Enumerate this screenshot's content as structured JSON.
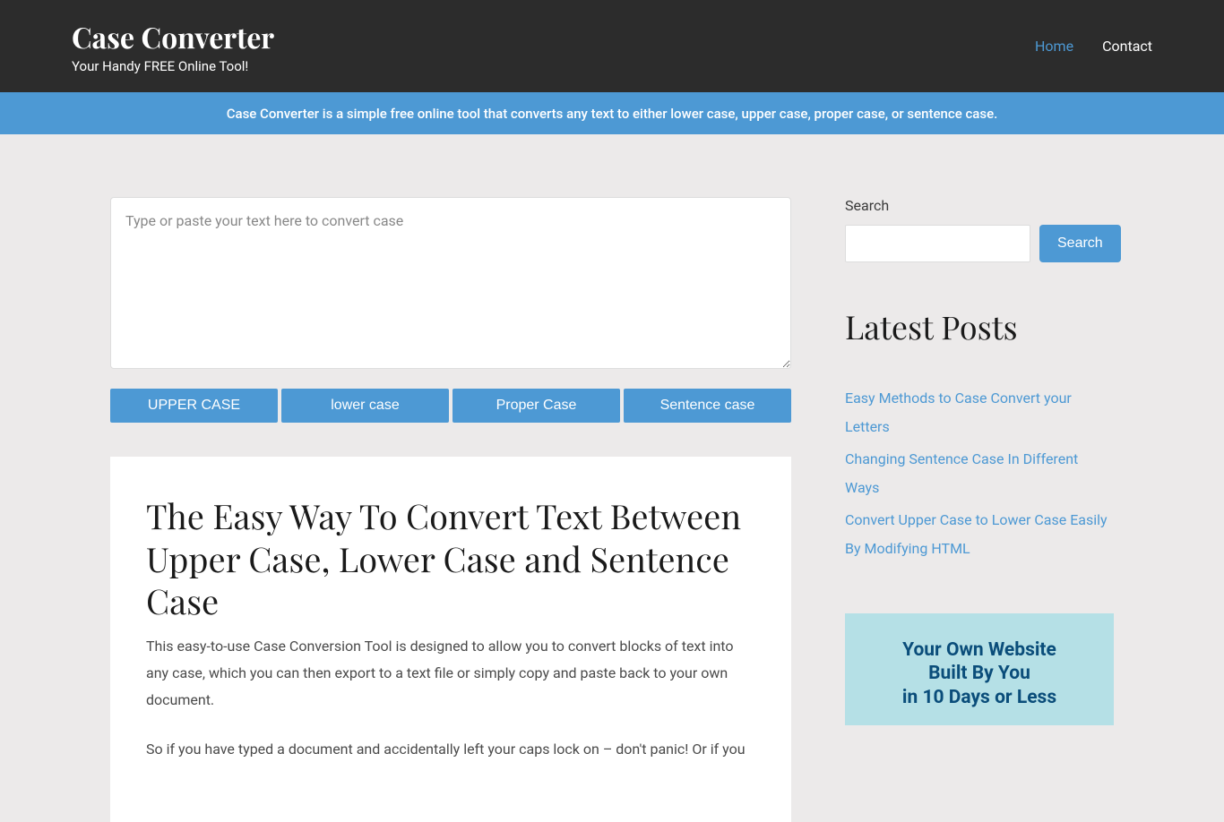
{
  "header": {
    "title": "Case Converter",
    "tagline": "Your Handy FREE Online Tool!",
    "nav": {
      "home": "Home",
      "contact": "Contact"
    }
  },
  "banner": {
    "text": "Case Converter is a simple free online tool that converts any text to either lower case, upper case, proper case, or sentence case."
  },
  "textarea": {
    "placeholder": "Type or paste your text here to convert case"
  },
  "buttons": {
    "upper": "UPPER CASE",
    "lower": "lower case",
    "proper": "Proper Case",
    "sentence": "Sentence case"
  },
  "article": {
    "title": "The Easy Way To Convert Text Between Upper Case, Lower Case and Sentence Case",
    "p1": "This easy-to-use Case Conversion Tool is designed to allow you to convert blocks of text into any case, which you can then export to a text file or simply copy and paste back to your own document.",
    "p2": "So if you have typed a document and accidentally left your caps lock on – don't panic! Or if you"
  },
  "sidebar": {
    "searchLabel": "Search",
    "searchButton": "Search",
    "postsHeading": "Latest Posts",
    "posts": [
      "Easy Methods to Case Convert your Letters",
      "Changing Sentence Case In Different Ways",
      "Convert Upper Case to Lower Case Easily By Modifying HTML"
    ],
    "promo": {
      "line1": "Your Own Website",
      "line2": "Built By You",
      "line3": "in 10 Days or Less"
    }
  }
}
